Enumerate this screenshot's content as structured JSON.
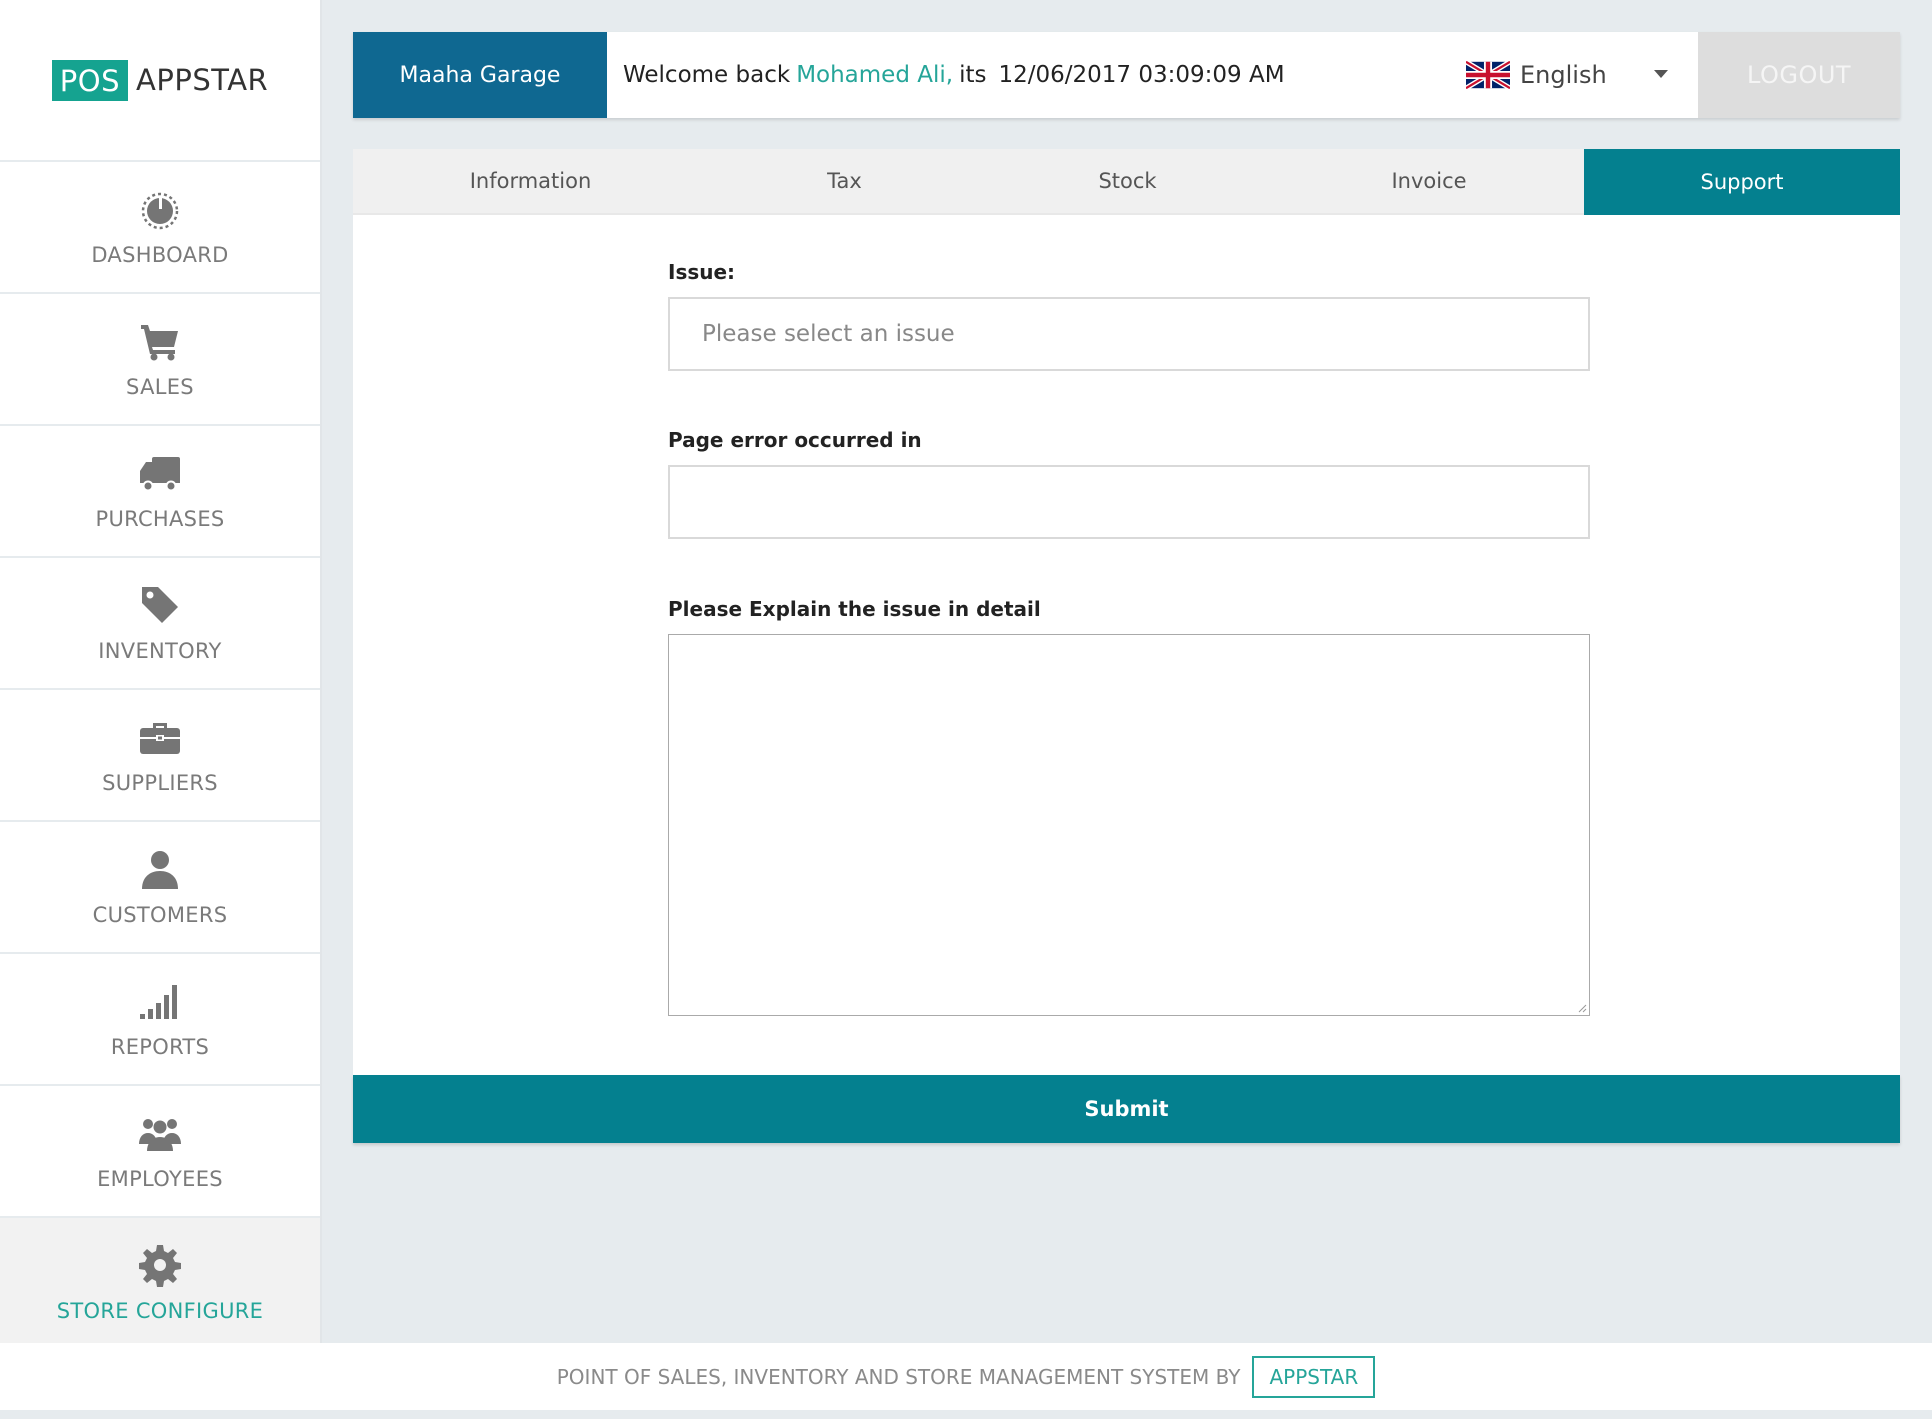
{
  "logo": {
    "pos": "POS",
    "app": "APPSTAR"
  },
  "sidebar": {
    "items": [
      {
        "label": "DASHBOARD",
        "icon": "dashboard-icon"
      },
      {
        "label": "SALES",
        "icon": "cart-icon"
      },
      {
        "label": "PURCHASES",
        "icon": "truck-icon"
      },
      {
        "label": "INVENTORY",
        "icon": "tag-icon"
      },
      {
        "label": "SUPPLIERS",
        "icon": "briefcase-icon"
      },
      {
        "label": "CUSTOMERS",
        "icon": "user-icon"
      },
      {
        "label": "REPORTS",
        "icon": "signal-bars-icon"
      },
      {
        "label": "EMPLOYEES",
        "icon": "group-icon"
      },
      {
        "label": "STORE CONFIGURE",
        "icon": "gear-icon",
        "active": true
      }
    ]
  },
  "header": {
    "store_name": "Maaha Garage",
    "welcome_prefix": "Welcome back",
    "user_name": "Mohamed Ali,",
    "its": "its",
    "datetime": "12/06/2017 03:09:09 AM",
    "language": "English",
    "language_flag": "uk-flag-icon",
    "logout": "LOGOUT"
  },
  "tabs": [
    {
      "label": "Information"
    },
    {
      "label": "Tax"
    },
    {
      "label": "Stock"
    },
    {
      "label": "Invoice"
    },
    {
      "label": "Support",
      "active": true
    }
  ],
  "form": {
    "issue_label": "Issue:",
    "issue_placeholder": "Please select an issue",
    "page_error_label": "Page error occurred in",
    "page_error_value": "",
    "detail_label": "Please Explain the issue in detail",
    "detail_value": "",
    "submit": "Submit"
  },
  "footer": {
    "text": "POINT OF SALES, INVENTORY AND STORE MANAGEMENT SYSTEM BY",
    "brand": "APPSTAR"
  },
  "colors": {
    "accent": "#04808f",
    "brand_green": "#25a599",
    "header_blue": "#0f6891",
    "background": "#e6ebee"
  }
}
